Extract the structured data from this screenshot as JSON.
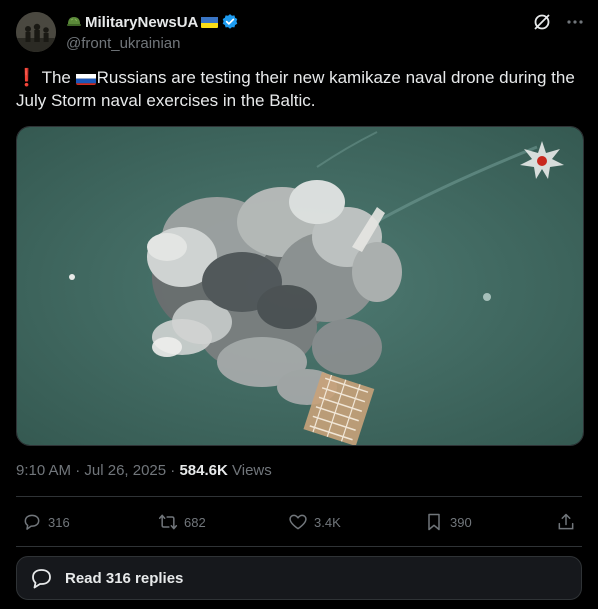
{
  "author": {
    "display_name": "MilitaryNewsUA",
    "handle": "@front_ukrainian",
    "verified": true,
    "badge_icon": "green-helmet-icon",
    "flag_icon": "ukraine-flag-icon"
  },
  "tweet": {
    "exclaim": "❗",
    "text_before_flag": "The ",
    "text_after_flag": "Russians are testing their new kamikaze naval drone during the July Storm naval exercises in the Baltic.",
    "flag_icon": "russia-flag-icon"
  },
  "media": {
    "watermark_icon": "russian-mod-emblem-icon"
  },
  "meta": {
    "time": "9:10 AM",
    "date": "Jul 26, 2025",
    "views_count": "584.6K",
    "views_label": "Views",
    "dot": "·"
  },
  "actions": {
    "replies": "316",
    "reposts": "682",
    "likes": "3.4K",
    "bookmarks": "390"
  },
  "read_replies_label": "Read 316 replies",
  "colors": {
    "background": "#000000",
    "text": "#e7e9ea",
    "muted": "#71767b",
    "border": "#2f3336",
    "verified": "#1d9bf0"
  }
}
